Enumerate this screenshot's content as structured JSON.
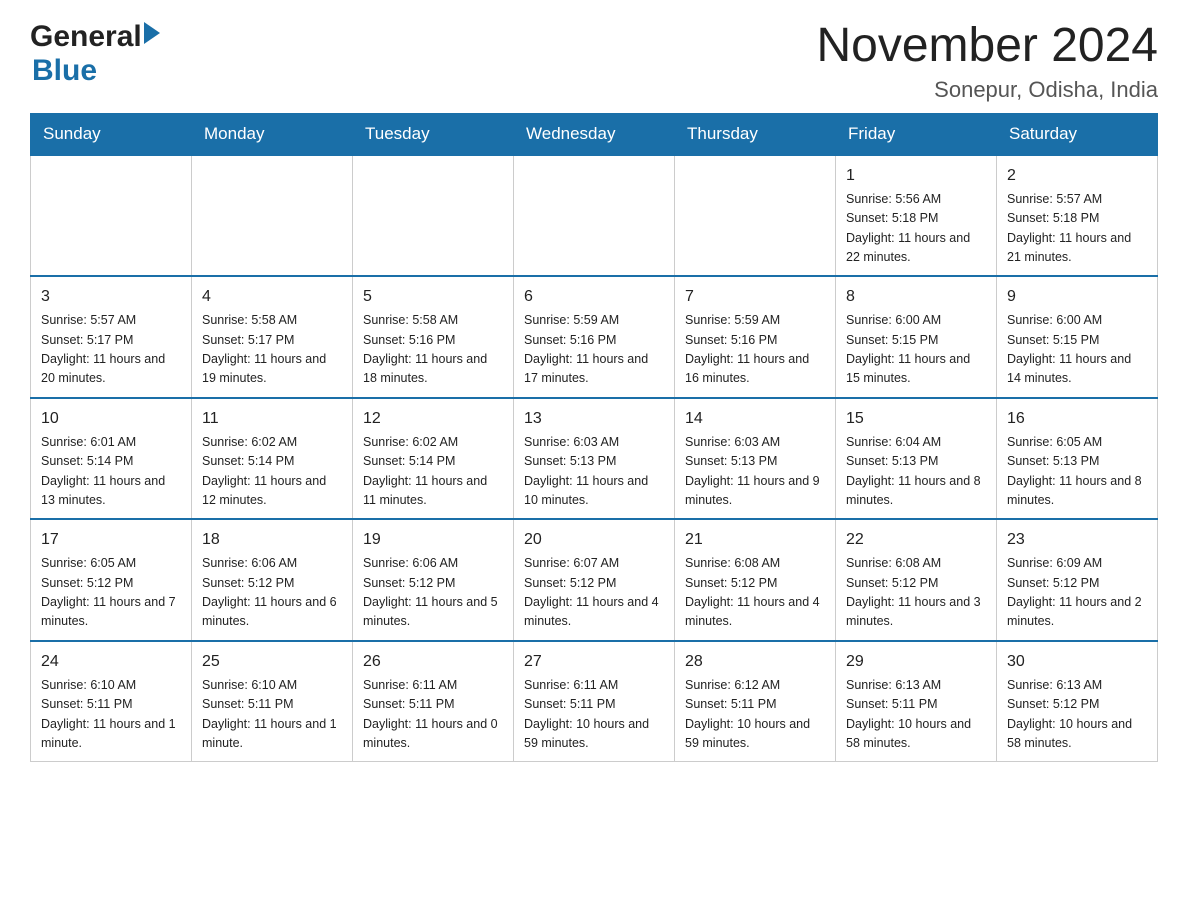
{
  "logo": {
    "general": "General",
    "blue": "Blue"
  },
  "title": "November 2024",
  "subtitle": "Sonepur, Odisha, India",
  "weekdays": [
    "Sunday",
    "Monday",
    "Tuesday",
    "Wednesday",
    "Thursday",
    "Friday",
    "Saturday"
  ],
  "weeks": [
    [
      {
        "day": "",
        "info": ""
      },
      {
        "day": "",
        "info": ""
      },
      {
        "day": "",
        "info": ""
      },
      {
        "day": "",
        "info": ""
      },
      {
        "day": "",
        "info": ""
      },
      {
        "day": "1",
        "info": "Sunrise: 5:56 AM\nSunset: 5:18 PM\nDaylight: 11 hours\nand 22 minutes."
      },
      {
        "day": "2",
        "info": "Sunrise: 5:57 AM\nSunset: 5:18 PM\nDaylight: 11 hours\nand 21 minutes."
      }
    ],
    [
      {
        "day": "3",
        "info": "Sunrise: 5:57 AM\nSunset: 5:17 PM\nDaylight: 11 hours\nand 20 minutes."
      },
      {
        "day": "4",
        "info": "Sunrise: 5:58 AM\nSunset: 5:17 PM\nDaylight: 11 hours\nand 19 minutes."
      },
      {
        "day": "5",
        "info": "Sunrise: 5:58 AM\nSunset: 5:16 PM\nDaylight: 11 hours\nand 18 minutes."
      },
      {
        "day": "6",
        "info": "Sunrise: 5:59 AM\nSunset: 5:16 PM\nDaylight: 11 hours\nand 17 minutes."
      },
      {
        "day": "7",
        "info": "Sunrise: 5:59 AM\nSunset: 5:16 PM\nDaylight: 11 hours\nand 16 minutes."
      },
      {
        "day": "8",
        "info": "Sunrise: 6:00 AM\nSunset: 5:15 PM\nDaylight: 11 hours\nand 15 minutes."
      },
      {
        "day": "9",
        "info": "Sunrise: 6:00 AM\nSunset: 5:15 PM\nDaylight: 11 hours\nand 14 minutes."
      }
    ],
    [
      {
        "day": "10",
        "info": "Sunrise: 6:01 AM\nSunset: 5:14 PM\nDaylight: 11 hours\nand 13 minutes."
      },
      {
        "day": "11",
        "info": "Sunrise: 6:02 AM\nSunset: 5:14 PM\nDaylight: 11 hours\nand 12 minutes."
      },
      {
        "day": "12",
        "info": "Sunrise: 6:02 AM\nSunset: 5:14 PM\nDaylight: 11 hours\nand 11 minutes."
      },
      {
        "day": "13",
        "info": "Sunrise: 6:03 AM\nSunset: 5:13 PM\nDaylight: 11 hours\nand 10 minutes."
      },
      {
        "day": "14",
        "info": "Sunrise: 6:03 AM\nSunset: 5:13 PM\nDaylight: 11 hours\nand 9 minutes."
      },
      {
        "day": "15",
        "info": "Sunrise: 6:04 AM\nSunset: 5:13 PM\nDaylight: 11 hours\nand 8 minutes."
      },
      {
        "day": "16",
        "info": "Sunrise: 6:05 AM\nSunset: 5:13 PM\nDaylight: 11 hours\nand 8 minutes."
      }
    ],
    [
      {
        "day": "17",
        "info": "Sunrise: 6:05 AM\nSunset: 5:12 PM\nDaylight: 11 hours\nand 7 minutes."
      },
      {
        "day": "18",
        "info": "Sunrise: 6:06 AM\nSunset: 5:12 PM\nDaylight: 11 hours\nand 6 minutes."
      },
      {
        "day": "19",
        "info": "Sunrise: 6:06 AM\nSunset: 5:12 PM\nDaylight: 11 hours\nand 5 minutes."
      },
      {
        "day": "20",
        "info": "Sunrise: 6:07 AM\nSunset: 5:12 PM\nDaylight: 11 hours\nand 4 minutes."
      },
      {
        "day": "21",
        "info": "Sunrise: 6:08 AM\nSunset: 5:12 PM\nDaylight: 11 hours\nand 4 minutes."
      },
      {
        "day": "22",
        "info": "Sunrise: 6:08 AM\nSunset: 5:12 PM\nDaylight: 11 hours\nand 3 minutes."
      },
      {
        "day": "23",
        "info": "Sunrise: 6:09 AM\nSunset: 5:12 PM\nDaylight: 11 hours\nand 2 minutes."
      }
    ],
    [
      {
        "day": "24",
        "info": "Sunrise: 6:10 AM\nSunset: 5:11 PM\nDaylight: 11 hours\nand 1 minute."
      },
      {
        "day": "25",
        "info": "Sunrise: 6:10 AM\nSunset: 5:11 PM\nDaylight: 11 hours\nand 1 minute."
      },
      {
        "day": "26",
        "info": "Sunrise: 6:11 AM\nSunset: 5:11 PM\nDaylight: 11 hours\nand 0 minutes."
      },
      {
        "day": "27",
        "info": "Sunrise: 6:11 AM\nSunset: 5:11 PM\nDaylight: 10 hours\nand 59 minutes."
      },
      {
        "day": "28",
        "info": "Sunrise: 6:12 AM\nSunset: 5:11 PM\nDaylight: 10 hours\nand 59 minutes."
      },
      {
        "day": "29",
        "info": "Sunrise: 6:13 AM\nSunset: 5:11 PM\nDaylight: 10 hours\nand 58 minutes."
      },
      {
        "day": "30",
        "info": "Sunrise: 6:13 AM\nSunset: 5:12 PM\nDaylight: 10 hours\nand 58 minutes."
      }
    ]
  ]
}
